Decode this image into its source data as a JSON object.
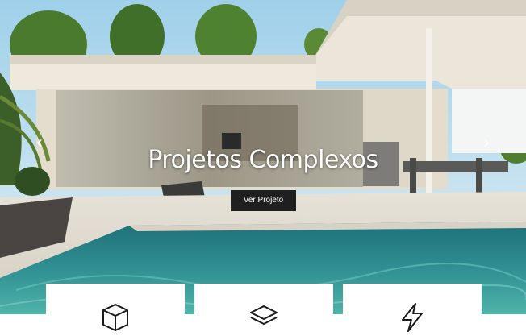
{
  "hero": {
    "title": "Projetos Complexos",
    "cta_label": "Ver Projeto",
    "prev_glyph": "‹",
    "next_glyph": "›"
  },
  "features": [
    {
      "icon": "cube-icon"
    },
    {
      "icon": "layers-icon"
    },
    {
      "icon": "lightning-icon"
    }
  ],
  "colors": {
    "sky": "#e6eef2",
    "pool": "#2e8a8e",
    "button": "#1f1f1f",
    "card": "#ffffff"
  }
}
